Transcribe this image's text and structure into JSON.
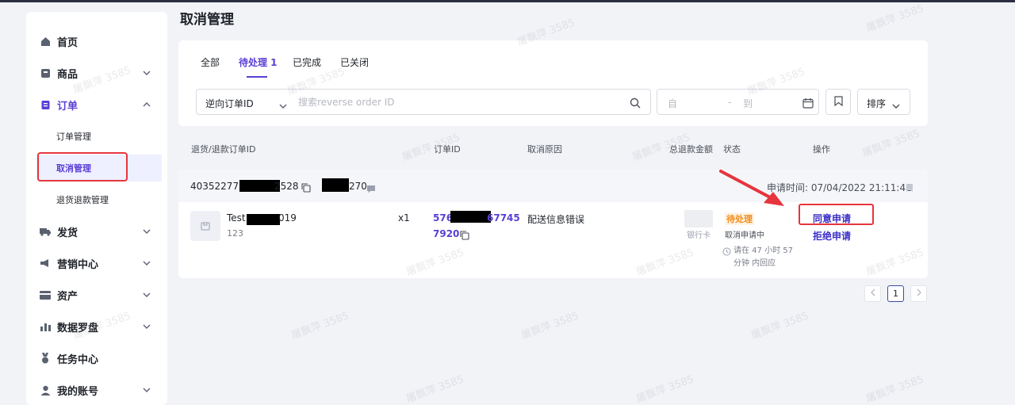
{
  "sidebar": {
    "items": [
      {
        "label": "首页",
        "icon": "home-icon"
      },
      {
        "label": "商品",
        "icon": "product-icon"
      },
      {
        "label": "订单",
        "icon": "order-icon"
      },
      {
        "label": "发货",
        "icon": "truck-icon"
      },
      {
        "label": "营销中心",
        "icon": "megaphone-icon"
      },
      {
        "label": "资产",
        "icon": "card-icon"
      },
      {
        "label": "数据罗盘",
        "icon": "chart-icon"
      },
      {
        "label": "任务中心",
        "icon": "medal-icon"
      },
      {
        "label": "我的账号",
        "icon": "user-icon"
      }
    ],
    "order_sub_items": [
      {
        "label": "订单管理"
      },
      {
        "label": "取消管理"
      },
      {
        "label": "退货退款管理"
      }
    ]
  },
  "page": {
    "title": "取消管理"
  },
  "tabs": [
    {
      "label": "全部"
    },
    {
      "label": "待处理 1"
    },
    {
      "label": "已完成"
    },
    {
      "label": "已关闭"
    }
  ],
  "search": {
    "type_label": "逆向订单ID",
    "placeholder": "搜索reverse order ID",
    "date_from": "自",
    "date_dash": "-",
    "date_to": "到",
    "sort_label": "排序"
  },
  "table": {
    "headers": [
      "退货/退款订单ID",
      "订单ID",
      "取消原因",
      "总退款金额",
      "状态",
      "操作"
    ]
  },
  "order": {
    "reverse_id_prefix": "40352277",
    "reverse_id_suffix": "2528",
    "second_id_suffix": "270",
    "apply_time": "申请时间: 07/04/2022 21:11:42",
    "product_name_prefix": "Test",
    "product_name_suffix": "019",
    "product_sku": "123",
    "quantity": "x1",
    "order_id_prefix": "576",
    "order_id_suffix": "67745",
    "order_id_line2": "7920",
    "cancel_reason": "配送信息错误",
    "payment_method": "银行卡",
    "status": "待处理",
    "status_detail": "取消申请中",
    "respond_line1": "请在 47 小时 57",
    "respond_line2": "分钟 内回应",
    "approve_label": "同意申请",
    "reject_label": "拒绝申请"
  },
  "pagination": {
    "current": "1"
  },
  "watermark": "屠飘萍 3585",
  "colors": {
    "accent": "#5b3fd6",
    "highlight_red": "#e6353d",
    "status_orange": "#f28c1a"
  }
}
